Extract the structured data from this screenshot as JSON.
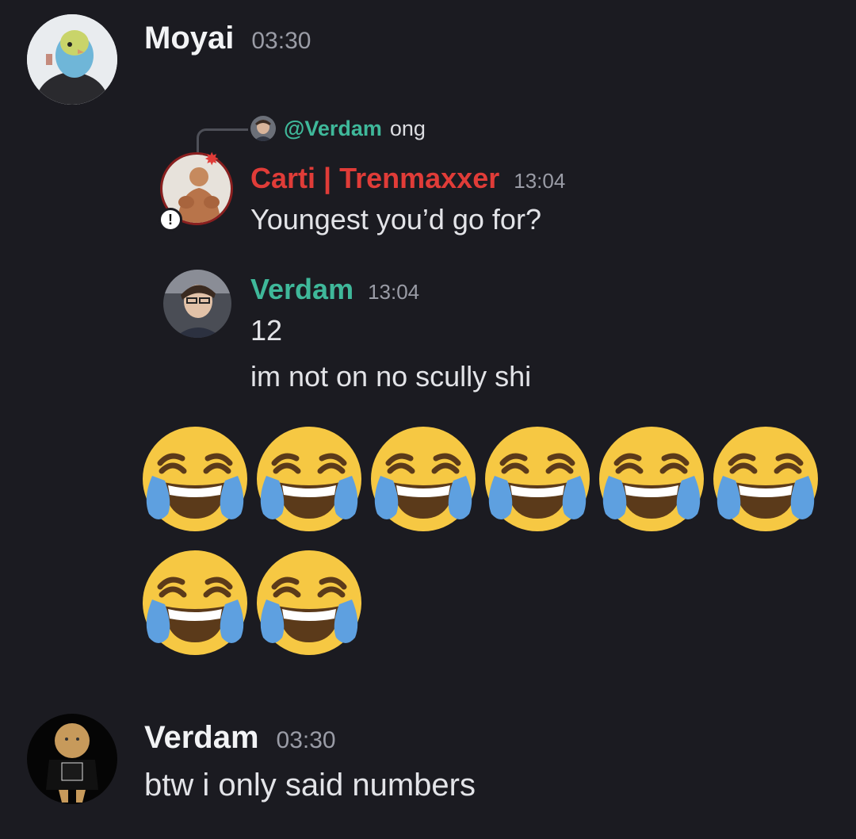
{
  "message1": {
    "author": "Moyai",
    "time": "03:30",
    "reply": {
      "mention": "@Verdam",
      "text": "ong"
    },
    "quoted": [
      {
        "author": "Carti | Trenmaxxer",
        "author_color": "#e03c38",
        "time": "13:04",
        "lines": [
          "Youngest you’d go for?"
        ]
      },
      {
        "author": "Verdam",
        "author_color": "#3fb89a",
        "time": "13:04",
        "lines": [
          "12",
          "im not on no scully shi"
        ]
      }
    ],
    "emoji": {
      "name": "face-with-tears-of-joy-icon",
      "count": 8
    }
  },
  "message2": {
    "author": "Verdam",
    "time": "03:30",
    "text": "btw i only said numbers"
  },
  "colors": {
    "background": "#1b1b21",
    "username": "#f2f3f5",
    "timestamp": "#9a9ca6"
  }
}
